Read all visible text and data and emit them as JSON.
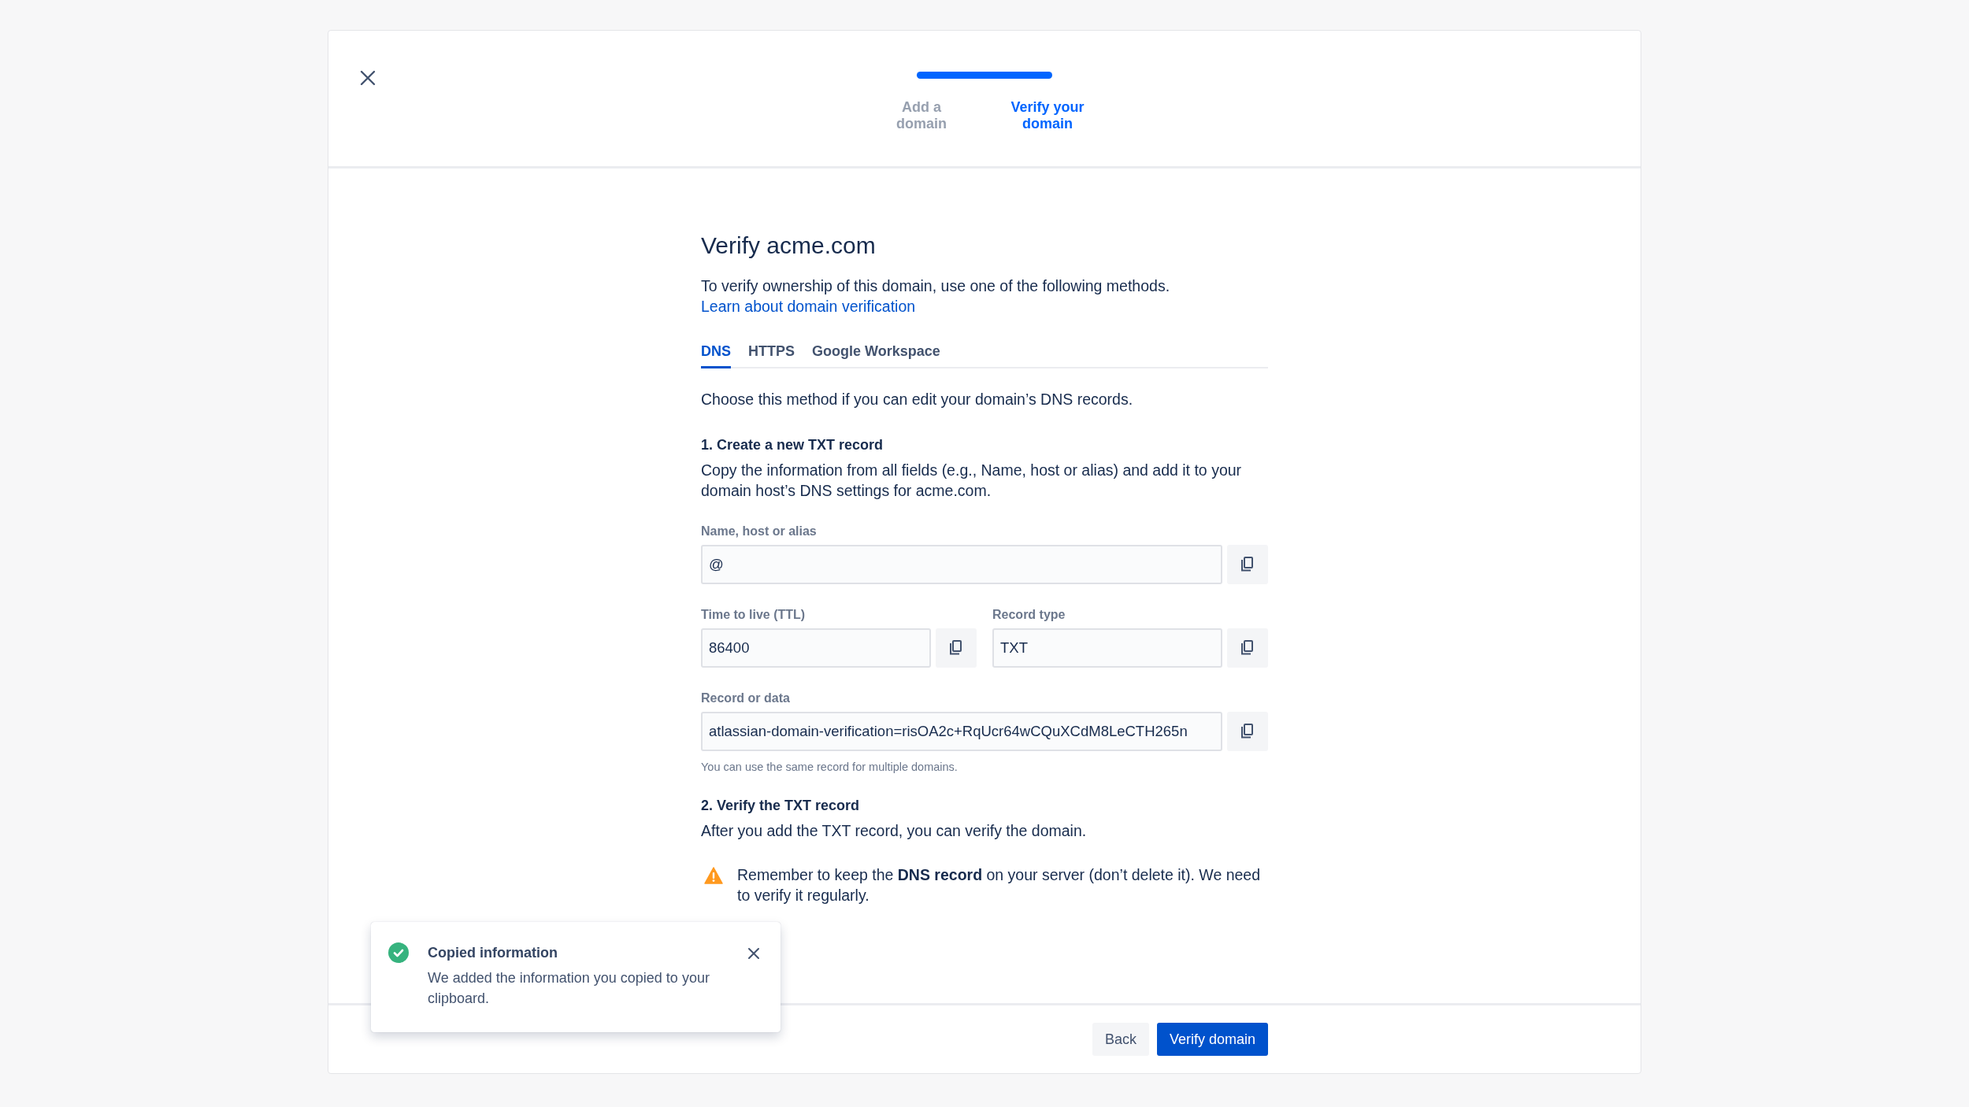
{
  "header": {
    "progress": {
      "level": 1
    },
    "steps": [
      {
        "label": "Add a domain",
        "selected": false
      },
      {
        "label": "Verify your domain",
        "selected": true
      }
    ]
  },
  "title": "Verify acme.com",
  "intro": {
    "text": "To verify ownership of this domain, use one of the following methods.",
    "link": "Learn about domain verification"
  },
  "tabs": [
    {
      "label": "DNS",
      "selected": true
    },
    {
      "label": "HTTPS",
      "selected": false
    },
    {
      "label": "Google Workspace",
      "selected": false
    }
  ],
  "method_description": "Choose this method if you can edit your domain’s DNS records.",
  "step1": {
    "heading": "1. Create a new TXT record",
    "text": "Copy the information from all fields (e.g., Name, host or alias) and add it to your domain host’s DNS settings for acme.com."
  },
  "field_rows": [
    [
      {
        "label": "Name, host or alias",
        "value": "@"
      }
    ],
    [
      {
        "label": "Time to live (TTL)",
        "value": "86400"
      },
      {
        "label": "Record type",
        "value": "TXT"
      }
    ],
    [
      {
        "label": "Record or data",
        "value": "atlassian-domain-verification=risOA2c+RqUcr64wCQuXCdM8LeCTH265n",
        "hint": "You can use the same record for multiple domains."
      }
    ]
  ],
  "step2": {
    "heading": "2. Verify the TXT record",
    "text": "After you add the TXT record, you can verify the domain."
  },
  "warning": "Remember to keep the **DNS record** on your server (don’t delete it). We need to verify it regularly.",
  "footer": {
    "buttons": [
      {
        "label": "Back",
        "kind": "secondary"
      },
      {
        "label": "Verify domain",
        "kind": "primary"
      }
    ]
  },
  "toast": {
    "title": "Copied information",
    "text": "We added the information you copied to your clipboard."
  }
}
